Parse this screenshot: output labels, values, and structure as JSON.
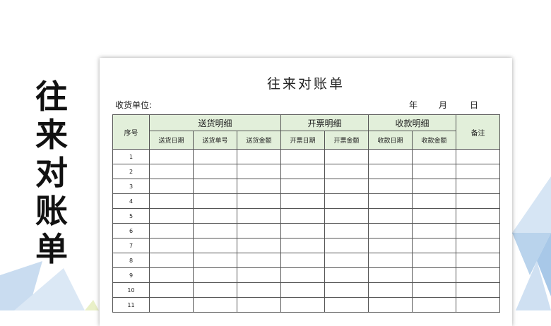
{
  "side_title": [
    "往",
    "来",
    "对",
    "账",
    "单"
  ],
  "document": {
    "title": "往来对账单",
    "recipient_label": "收货单位:",
    "year_label": "年",
    "month_label": "月",
    "day_label": "日"
  },
  "table": {
    "serial_header": "序号",
    "groups": {
      "delivery": "送货明细",
      "invoice": "开票明细",
      "payment": "收款明细"
    },
    "remark_header": "备注",
    "sub_headers": {
      "delivery_date": "送货日期",
      "delivery_no": "送货单号",
      "delivery_amount": "送货金额",
      "invoice_date": "开票日期",
      "invoice_amount": "开票金额",
      "payment_date": "收款日期",
      "payment_amount": "收款金额"
    },
    "rows": [
      "1",
      "2",
      "3",
      "4",
      "5",
      "6",
      "7",
      "8",
      "9",
      "10",
      "11"
    ]
  },
  "colors": {
    "header_fill": "#e2efda",
    "deco_blue": "#b9d3ec"
  }
}
